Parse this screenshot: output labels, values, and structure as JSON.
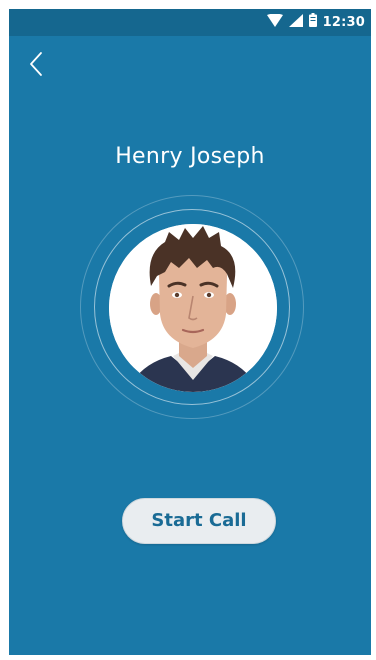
{
  "status_bar": {
    "time": "12:30",
    "icons": [
      "wifi-icon",
      "cellular-signal-icon",
      "battery-icon"
    ]
  },
  "header": {
    "back_icon": "chevron-left-icon"
  },
  "contact": {
    "name": "Henry Joseph",
    "avatar": "contact-photo"
  },
  "actions": {
    "start_call_label": "Start Call"
  },
  "colors": {
    "background": "#1a79a8",
    "status_bar": "#15678f",
    "button_bg": "#e9edf0",
    "button_text": "#1a6b95"
  }
}
